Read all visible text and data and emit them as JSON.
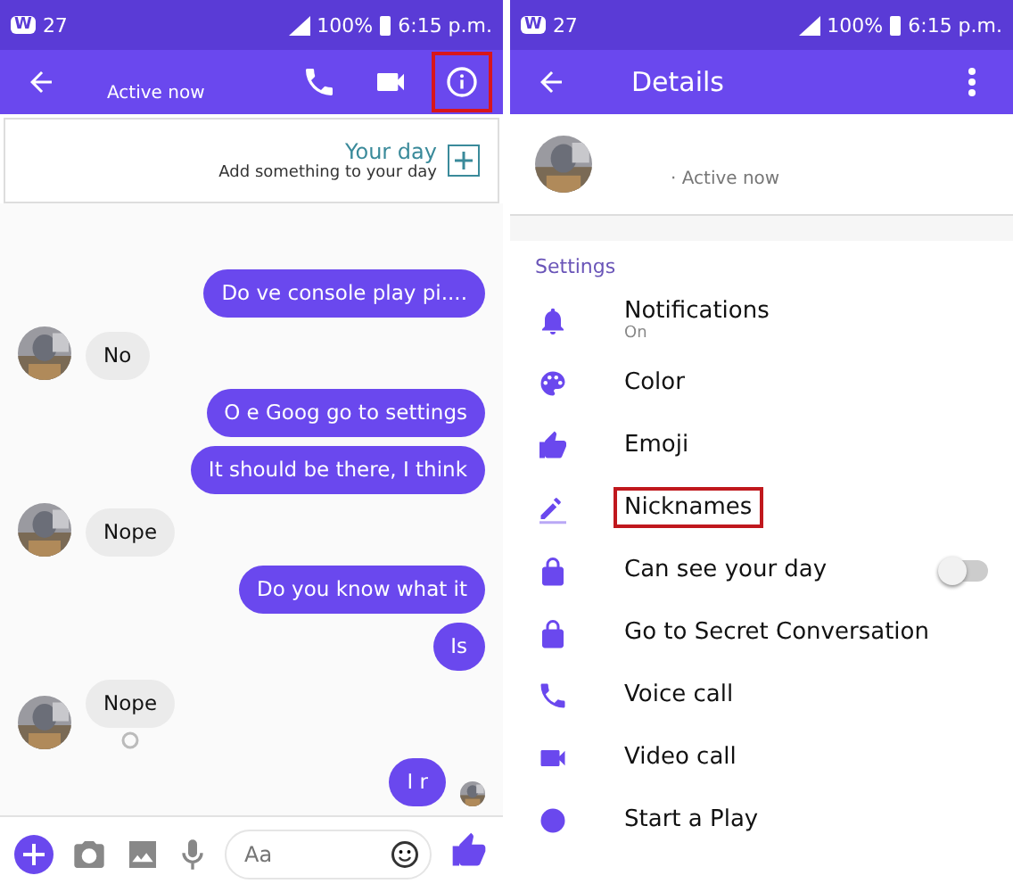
{
  "chat": {
    "status_bar": {
      "app_badge": "W",
      "label": "27",
      "battery": "100%",
      "time": "6:15 p.m."
    },
    "header": {
      "subtitle": "Active now",
      "buttons": [
        {
          "kind": "call",
          "highlighted": false
        },
        {
          "kind": "video",
          "highlighted": false
        },
        {
          "kind": "info",
          "highlighted": true
        }
      ]
    },
    "your_day": {
      "title": "Your day",
      "subtitle": "Add something to your day"
    },
    "messages": [
      {
        "kind": "outgoing",
        "text": "Do ve console play pi....",
        "seen": false,
        "read_receipt": false
      },
      {
        "kind": "incoming",
        "text": "No",
        "seen": false,
        "read_receipt": false
      },
      {
        "kind": "outgoing",
        "text": "O e Goog go to settings",
        "seen": false,
        "read_receipt": false
      },
      {
        "kind": "outgoing",
        "text": "It should be there, I think",
        "seen": false,
        "read_receipt": false
      },
      {
        "kind": "incoming",
        "text": "Nope",
        "seen": false,
        "read_receipt": false
      },
      {
        "kind": "outgoing",
        "text": "Do you know what it",
        "seen": false,
        "read_receipt": false
      },
      {
        "kind": "outgoing",
        "text": "Is",
        "seen": false,
        "read_receipt": false
      },
      {
        "kind": "incoming",
        "text": "Nope",
        "seen": true,
        "read_receipt": false
      },
      {
        "kind": "outgoing",
        "text": "I r",
        "seen": false,
        "read_receipt": true
      }
    ],
    "composer": {
      "placeholder": "Aa"
    }
  },
  "details": {
    "status_bar": {
      "app_badge": "W",
      "label": "27",
      "battery": "100%",
      "time": "6:15 p.m."
    },
    "header": {
      "title": "Details"
    },
    "profile": {
      "status": "· Active now"
    },
    "section_title": "Settings",
    "items": [
      {
        "kind": "bell",
        "label": "Notifications",
        "sublabel": "On",
        "highlighted": false
      },
      {
        "kind": "palette",
        "label": "Color",
        "highlighted": false
      },
      {
        "kind": "thumb",
        "label": "Emoji",
        "highlighted": false
      },
      {
        "kind": "pencil",
        "label": "Nicknames",
        "highlighted": true
      },
      {
        "kind": "lock",
        "label": "Can see your day",
        "highlighted": false,
        "toggle": {
          "on": false
        }
      },
      {
        "kind": "lock",
        "label": "Go to Secret Conversation",
        "highlighted": false
      },
      {
        "kind": "call",
        "label": "Voice call",
        "highlighted": false
      },
      {
        "kind": "video",
        "label": "Video call",
        "highlighted": false
      },
      {
        "kind": "game",
        "label": "Start a Play",
        "highlighted": false
      }
    ]
  }
}
